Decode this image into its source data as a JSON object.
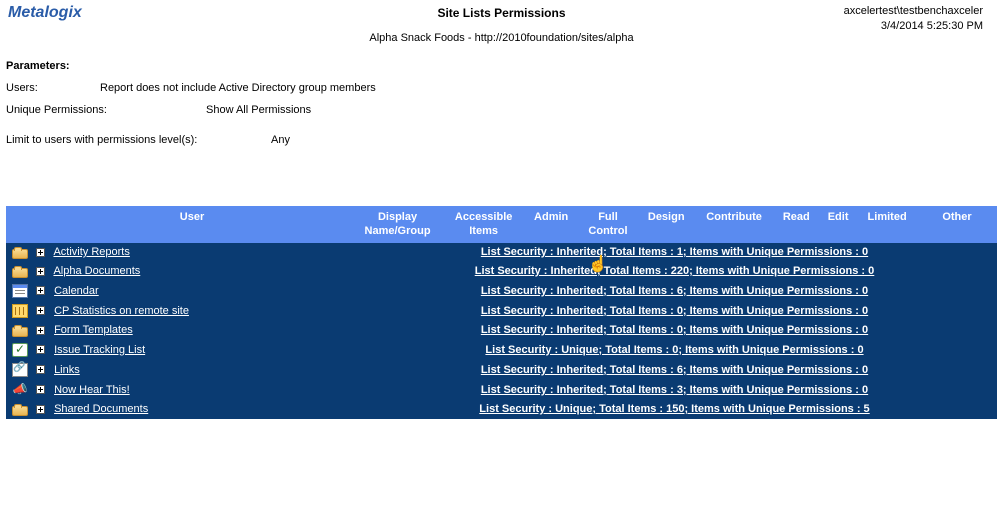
{
  "brand": "Metalogix",
  "title": "Site Lists Permissions",
  "user": "axcelertest\\testbenchaxceler",
  "timestamp": "3/4/2014 5:25:30 PM",
  "subtitle": "Alpha Snack Foods - http://2010foundation/sites/alpha",
  "parameters_label": "Parameters:",
  "params": {
    "users_label": "Users:",
    "users_value": "Report does not include Active Directory group members",
    "uniq_label": "Unique Permissions:",
    "uniq_value": "Show All Permissions",
    "limit_label": "Limit to users with permissions level(s):",
    "limit_value": "Any"
  },
  "columns": {
    "user": "User",
    "display": "Display\nName/Group",
    "accessible": "Accessible\nItems",
    "admin": "Admin",
    "full": "Full\nControl",
    "design": "Design",
    "contribute": "Contribute",
    "read": "Read",
    "edit": "Edit",
    "limited": "Limited",
    "other": "Other"
  },
  "rows": [
    {
      "name": "Activity Reports",
      "icon": "folder",
      "security": "List Security : Inherited; Total Items : 1; Items with Unique Permissions : 0"
    },
    {
      "name": "Alpha Documents",
      "icon": "folder",
      "security": "List Security : Inherited; Total Items : 220; Items with Unique Permissions : 0"
    },
    {
      "name": "Calendar",
      "icon": "calendar",
      "security": "List Security : Inherited; Total Items : 6; Items with Unique Permissions : 0"
    },
    {
      "name": "CP Statistics on remote site",
      "icon": "sheet",
      "security": "List Security : Inherited; Total Items : 0; Items with Unique Permissions : 0"
    },
    {
      "name": "Form Templates",
      "icon": "folder",
      "security": "List Security : Inherited; Total Items : 0; Items with Unique Permissions : 0"
    },
    {
      "name": "Issue Tracking List",
      "icon": "issue",
      "security": "List Security : Unique; Total Items : 0; Items with Unique Permissions : 0"
    },
    {
      "name": "Links",
      "icon": "links",
      "security": "List Security : Inherited; Total Items : 6; Items with Unique Permissions : 0"
    },
    {
      "name": "Now Hear This!",
      "icon": "horn",
      "security": "List Security : Inherited; Total Items : 3; Items with Unique Permissions : 0"
    },
    {
      "name": "Shared Documents",
      "icon": "folder",
      "security": "List Security : Unique; Total Items : 150; Items with Unique Permissions : 5"
    }
  ]
}
